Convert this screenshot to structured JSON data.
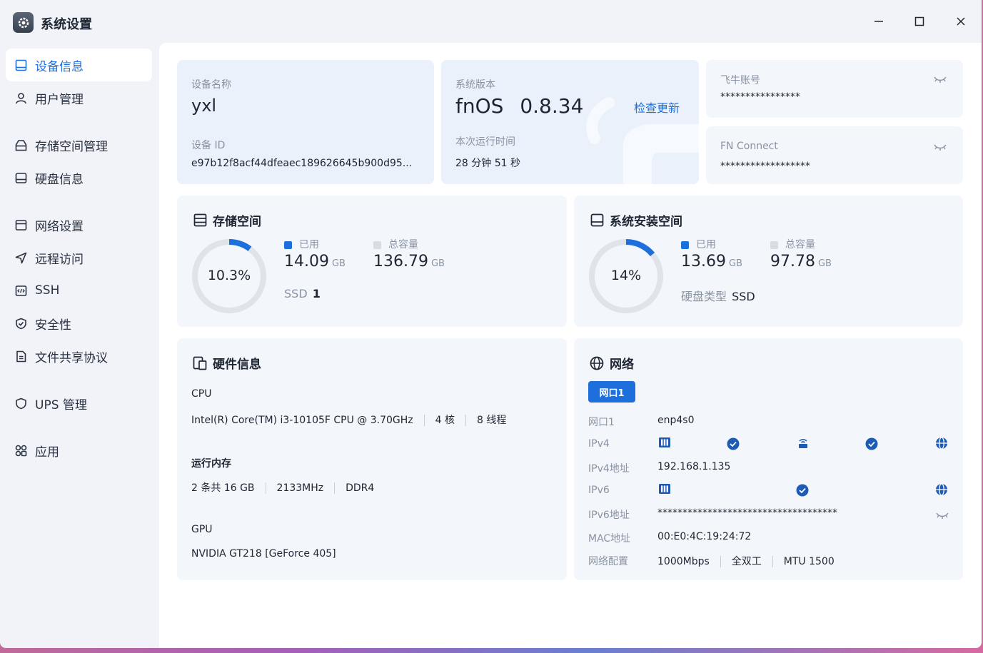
{
  "app": {
    "title": "系统设置"
  },
  "sidebar": {
    "items": [
      {
        "label": "设备信息",
        "icon": "device-icon",
        "active": true
      },
      {
        "label": "用户管理",
        "icon": "user-icon"
      },
      {
        "label": "存储空间管理",
        "icon": "storage-icon"
      },
      {
        "label": "硬盘信息",
        "icon": "disk-icon"
      },
      {
        "label": "网络设置",
        "icon": "network-icon"
      },
      {
        "label": "远程访问",
        "icon": "remote-icon"
      },
      {
        "label": "SSH",
        "icon": "ssh-icon"
      },
      {
        "label": "安全性",
        "icon": "shield-icon"
      },
      {
        "label": "文件共享协议",
        "icon": "file-share-icon"
      },
      {
        "label": "UPS 管理",
        "icon": "ups-icon"
      },
      {
        "label": "应用",
        "icon": "apps-icon"
      }
    ]
  },
  "device": {
    "name_label": "设备名称",
    "name": "yxl",
    "id_label": "设备 ID",
    "id": "e97b12f8acf44dfeaec189626645b900d95..."
  },
  "version": {
    "label": "系统版本",
    "os": "fnOS",
    "number": "0.8.34",
    "check_update": "检查更新",
    "uptime_label": "本次运行时间",
    "uptime": "28 分钟 51 秒"
  },
  "account": {
    "label": "飞牛账号",
    "value": "****************"
  },
  "fnconnect": {
    "label": "FN Connect",
    "value": "******************"
  },
  "storage": {
    "title": "存储空间",
    "percent_text": "10.3%",
    "percent": 10.3,
    "used_label": "已用",
    "used": "14.09",
    "used_unit": "GB",
    "total_label": "总容量",
    "total": "136.79",
    "total_unit": "GB",
    "disk_type": "SSD",
    "disk_count": "1"
  },
  "system_space": {
    "title": "系统安装空间",
    "percent_text": "14%",
    "percent": 14,
    "used_label": "已用",
    "used": "13.69",
    "used_unit": "GB",
    "total_label": "总容量",
    "total": "97.78",
    "total_unit": "GB",
    "disk_type_label": "硬盘类型",
    "disk_type": "SSD"
  },
  "hardware": {
    "title": "硬件信息",
    "cpu_label": "CPU",
    "cpu": "Intel(R) Core(TM) i3-10105F CPU @ 3.70GHz",
    "cores": "4 核",
    "threads": "8 线程",
    "mem_label": "运行内存",
    "mem": "2 条共 16 GB",
    "mem_speed": "2133MHz",
    "mem_type": "DDR4",
    "gpu_label": "GPU",
    "gpu": "NVIDIA GT218 [GeForce 405]"
  },
  "network": {
    "title": "网络",
    "tab": "网口1",
    "port_label": "网口1",
    "port": "enp4s0",
    "ipv4_label": "IPv4",
    "ipv4_addr_label": "IPv4地址",
    "ipv4_addr": "192.168.1.135",
    "ipv6_label": "IPv6",
    "ipv6_addr_label": "IPv6地址",
    "ipv6_addr": "************************************",
    "mac_label": "MAC地址",
    "mac": "00:E0:4C:19:24:72",
    "config_label": "网络配置",
    "speed": "1000Mbps",
    "duplex": "全双工",
    "mtu": "MTU 1500"
  },
  "colors": {
    "accent": "#1d6fdc",
    "ring_bg": "#dfe3ea",
    "legend_total": "#d8dce3"
  }
}
